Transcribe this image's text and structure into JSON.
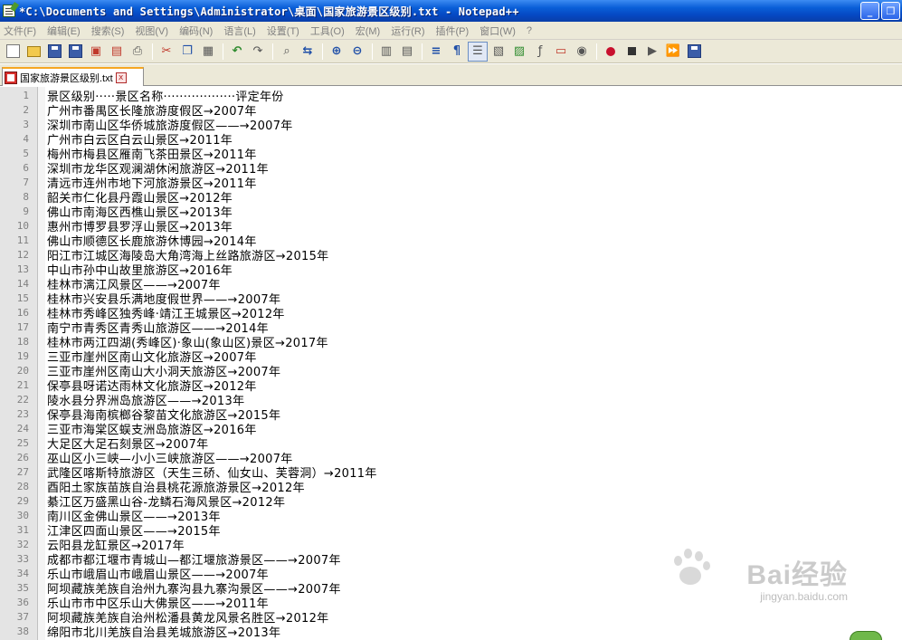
{
  "window": {
    "title": "*C:\\Documents and Settings\\Administrator\\桌面\\国家旅游景区级别.txt - Notepad++",
    "minimize_label": "_",
    "restore_label": "❐"
  },
  "menu": [
    "文件(F)",
    "编辑(E)",
    "搜索(S)",
    "视图(V)",
    "编码(N)",
    "语言(L)",
    "设置(T)",
    "工具(O)",
    "宏(M)",
    "运行(R)",
    "插件(P)",
    "窗口(W)",
    "?"
  ],
  "toolbar": {
    "icons": [
      "new-file-icon",
      "open-file-icon",
      "save-icon",
      "save-all-icon",
      "close-icon",
      "close-all-icon",
      "print-icon",
      "cut-icon",
      "copy-icon",
      "paste-icon",
      "undo-icon",
      "redo-icon",
      "find-icon",
      "replace-icon",
      "zoom-in-icon",
      "zoom-out-icon",
      "sync-vertical-icon",
      "sync-horizontal-icon",
      "word-wrap-icon",
      "show-all-chars-icon",
      "indent-guide-icon",
      "udl-icon",
      "doc-map-icon",
      "function-list-icon",
      "folder-workspace-icon",
      "monitor-icon",
      "record-macro-icon",
      "stop-record-icon",
      "play-macro-icon",
      "run-macro-multiple-icon",
      "save-macro-icon"
    ]
  },
  "tab": {
    "label": "国家旅游景区级别.txt",
    "close_label": "x"
  },
  "lines": [
    {
      "n": "1",
      "text": "景区级别·····景区名称··················评定年份"
    },
    {
      "n": "2",
      "text": "广州市番禺区长隆旅游度假区→2007年"
    },
    {
      "n": "3",
      "text": "深圳市南山区华侨城旅游度假区——→2007年"
    },
    {
      "n": "4",
      "text": "广州市白云区白云山景区→2011年"
    },
    {
      "n": "5",
      "text": "梅州市梅县区雁南飞茶田景区→2011年"
    },
    {
      "n": "6",
      "text": "深圳市龙华区观澜湖休闲旅游区→2011年"
    },
    {
      "n": "7",
      "text": "清远市连州市地下河旅游景区→2011年"
    },
    {
      "n": "8",
      "text": "韶关市仁化县丹霞山景区→2012年"
    },
    {
      "n": "9",
      "text": "佛山市南海区西樵山景区→2013年"
    },
    {
      "n": "10",
      "text": "惠州市博罗县罗浮山景区→2013年"
    },
    {
      "n": "11",
      "text": "佛山市顺德区长鹿旅游休博园→2014年"
    },
    {
      "n": "12",
      "text": "阳江市江城区海陵岛大角湾海上丝路旅游区→2015年"
    },
    {
      "n": "13",
      "text": "中山市孙中山故里旅游区→2016年"
    },
    {
      "n": "14",
      "text": "桂林市漓江风景区——→2007年"
    },
    {
      "n": "15",
      "text": "桂林市兴安县乐满地度假世界——→2007年"
    },
    {
      "n": "16",
      "text": "桂林市秀峰区独秀峰·靖江王城景区→2012年"
    },
    {
      "n": "17",
      "text": "南宁市青秀区青秀山旅游区——→2014年"
    },
    {
      "n": "18",
      "text": "桂林市两江四湖(秀峰区)·象山(象山区)景区→2017年"
    },
    {
      "n": "19",
      "text": "三亚市崖州区南山文化旅游区→2007年"
    },
    {
      "n": "20",
      "text": "三亚市崖州区南山大小洞天旅游区→2007年"
    },
    {
      "n": "21",
      "text": "保亭县呀诺达雨林文化旅游区→2012年"
    },
    {
      "n": "22",
      "text": "陵水县分界洲岛旅游区——→2013年"
    },
    {
      "n": "23",
      "text": "保亭县海南槟榔谷黎苗文化旅游区→2015年"
    },
    {
      "n": "24",
      "text": "三亚市海棠区蜈支洲岛旅游区→2016年"
    },
    {
      "n": "25",
      "text": "大足区大足石刻景区→2007年"
    },
    {
      "n": "26",
      "text": "巫山区小三峡—小小三峡旅游区——→2007年"
    },
    {
      "n": "27",
      "text": "武隆区喀斯特旅游区（天生三硚、仙女山、芙蓉洞）→2011年"
    },
    {
      "n": "28",
      "text": "酉阳土家族苗族自治县桃花源旅游景区→2012年"
    },
    {
      "n": "29",
      "text": "綦江区万盛黑山谷-龙鳞石海风景区→2012年"
    },
    {
      "n": "30",
      "text": "南川区金佛山景区——→2013年"
    },
    {
      "n": "31",
      "text": "江津区四面山景区——→2015年"
    },
    {
      "n": "32",
      "text": "云阳县龙缸景区→2017年"
    },
    {
      "n": "33",
      "text": "成都市都江堰市青城山—都江堰旅游景区——→2007年"
    },
    {
      "n": "34",
      "text": "乐山市峨眉山市峨眉山景区——→2007年"
    },
    {
      "n": "35",
      "text": "阿坝藏族羌族自治州九寨沟县九寨沟景区——→2007年"
    },
    {
      "n": "36",
      "text": "乐山市市中区乐山大佛景区——→2011年"
    },
    {
      "n": "37",
      "text": "阿坝藏族羌族自治州松潘县黄龙风景名胜区→2012年"
    },
    {
      "n": "38",
      "text": "绵阳市北川羌族自治县羌城旅游区→2013年"
    }
  ],
  "watermark": {
    "logo": "Bai经验",
    "url": "jingyan.baidu.com"
  }
}
